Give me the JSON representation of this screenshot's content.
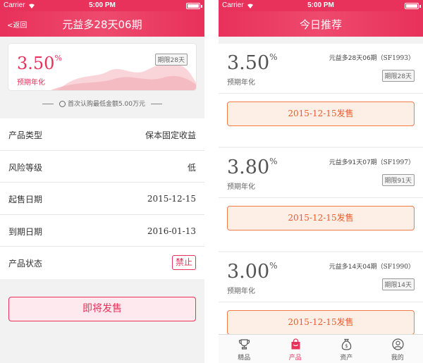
{
  "colors": {
    "accent": "#e8315b",
    "sale_orange": "#e85c2c",
    "sale_bg": "#fdeee6"
  },
  "status_bar": {
    "carrier": "Carrier",
    "time": "5:00 PM"
  },
  "left": {
    "nav": {
      "back_label": "返回",
      "title": "元益多28天06期"
    },
    "rate": {
      "value": "3.50",
      "unit": "%",
      "label": "预期年化"
    },
    "term": "期限28天",
    "min_purchase": "首次认购最低金额5.00万元",
    "rows": [
      {
        "label": "产品类型",
        "value": "保本固定收益"
      },
      {
        "label": "风险等级",
        "value": "低"
      },
      {
        "label": "起售日期",
        "value": "2015-12-15"
      },
      {
        "label": "到期日期",
        "value": "2016-01-13"
      },
      {
        "label": "产品状态",
        "value": "禁止"
      }
    ],
    "buy_button": "即将发售"
  },
  "right": {
    "nav": {
      "title": "今日推荐"
    },
    "products": [
      {
        "rate": "3.50",
        "unit": "%",
        "rate_label": "预期年化",
        "name": "元益多28天06期",
        "code": "（SF1993）",
        "term": "期限28天",
        "sale": "2015-12-15发售"
      },
      {
        "rate": "3.80",
        "unit": "%",
        "rate_label": "预期年化",
        "name": "元益多91天07期",
        "code": "（SF1997）",
        "term": "期限91天",
        "sale": "2015-12-15发售"
      },
      {
        "rate": "3.00",
        "unit": "%",
        "rate_label": "预期年化",
        "name": "元益多14天04期",
        "code": "（SF1990）",
        "term": "期限14天",
        "sale": "2015-12-15发售"
      }
    ],
    "tabs": [
      {
        "label": "精品",
        "icon": "trophy-icon"
      },
      {
        "label": "产品",
        "icon": "bag-icon"
      },
      {
        "label": "资产",
        "icon": "money-bag-icon"
      },
      {
        "label": "我的",
        "icon": "user-icon"
      }
    ]
  }
}
